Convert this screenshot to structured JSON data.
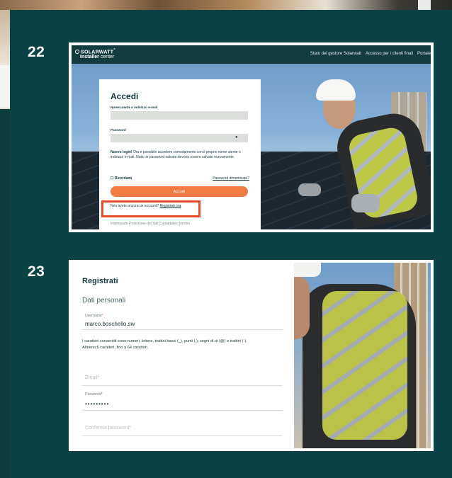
{
  "steps": {
    "first": "22",
    "second": "23"
  },
  "login_screen": {
    "brand": "SOLARWATT",
    "brand_mark": "°",
    "product_prefix": "Installer",
    "product_suffix": "center",
    "nav": [
      "Stato del gestore Solarwatt",
      "Accesso per i clienti finali",
      "Portale"
    ],
    "title": "Accedi",
    "username_label": "Nome utente o indirizzo e-mail",
    "password_label": "Password",
    "eye_icon": "eye-icon",
    "note_bold": "Nuovo login!",
    "note_text": " Ora è possibile accedere comodamente con il proprio nome utente o indirizzo e-mail. Nota: le password salvate devono essere salvate nuovamente.",
    "remember_label": "☐ Ricordami",
    "forgot_link": "Password dimenticata?",
    "login_button": "Accedi",
    "no_account_text": "Non avete ancora un account?",
    "register_link": "Registrati ora",
    "footer": "Impressum   Protezione dei dati   Contattateci   termini",
    "highlight_color": "#e84b2a",
    "button_color": "#f07b43"
  },
  "register_screen": {
    "title": "Registrati",
    "section": "Dati personali",
    "username_label": "Username",
    "required_mark": "*",
    "username_value": "marco.boschello.sw",
    "hint_line1": "I caratteri consentiti sono numeri, lettere, trattini bassi (_), punti (.), segni di at (@) e trattini (-).",
    "hint_line2": "Almeno 5 caratteri, fino a 64 caratteri.",
    "email_placeholder": "Email*",
    "password_label": "Password",
    "password_value": "•••••••••",
    "confirm_placeholder": "Conferma password*"
  },
  "colors": {
    "background": "#0b4246",
    "heading": "#133b3f"
  }
}
